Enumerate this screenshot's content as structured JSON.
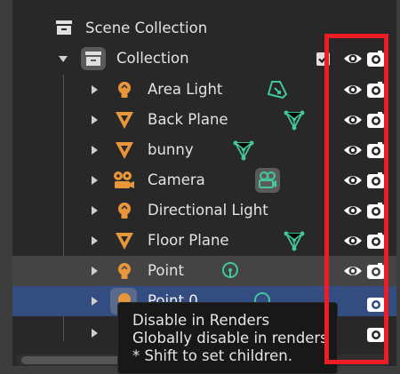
{
  "scene": {
    "title": "Scene Collection"
  },
  "collection": {
    "name": "Collection",
    "exclude_checked": true
  },
  "items": [
    {
      "label": "Area Light",
      "type": "light",
      "data_icon": "area-light-data-icon"
    },
    {
      "label": "Back Plane",
      "type": "mesh",
      "data_icon": "mesh-data-icon"
    },
    {
      "label": "bunny",
      "type": "mesh",
      "data_icon": "mesh-data-icon"
    },
    {
      "label": "Camera",
      "type": "camera",
      "data_icon": "camera-data-icon"
    },
    {
      "label": "Directional Light",
      "type": "light",
      "data_icon": ""
    },
    {
      "label": "Floor Plane",
      "type": "mesh",
      "data_icon": "mesh-data-icon"
    },
    {
      "label": "Point",
      "type": "light",
      "data_icon": "point-light-data-icon"
    },
    {
      "label": "Point.0",
      "type": "light",
      "data_icon": ""
    },
    {
      "label": "",
      "type": "",
      "data_icon": ""
    }
  ],
  "tooltip": {
    "line1": "Disable in Renders",
    "line2": "Globally disable in renders",
    "line3": "* Shift to set children."
  },
  "colors": {
    "background": "#282828",
    "selected_row": "#334d80",
    "object_icon": "#e8963a",
    "data_icon": "#43c79f",
    "highlight_box": "#ee1c25"
  }
}
